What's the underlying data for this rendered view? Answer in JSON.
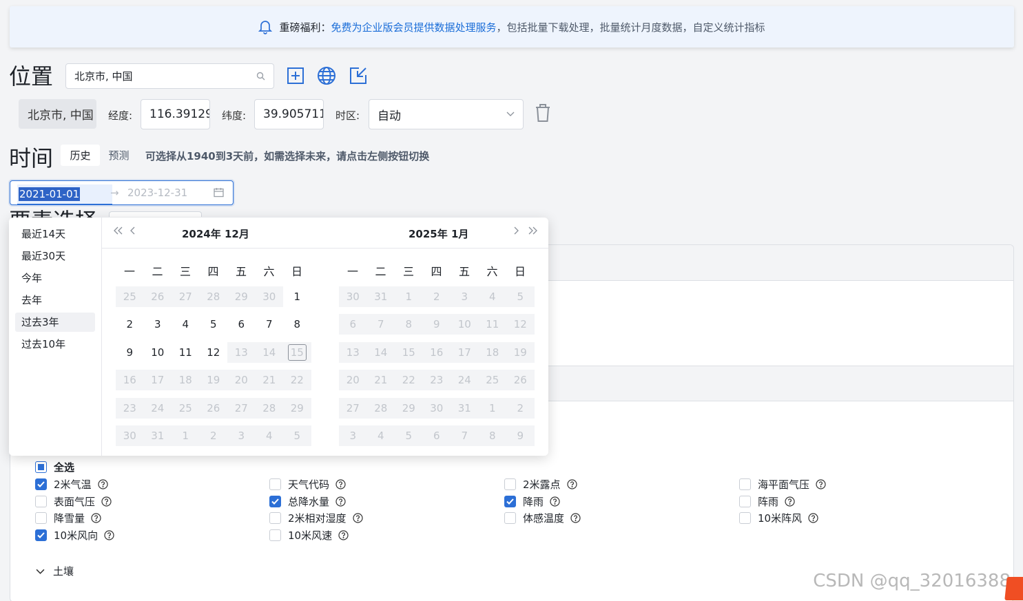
{
  "banner": {
    "lead": "重磅福利",
    "colon": "：",
    "link": "免费为企业版会员提供数据处理服务",
    "rest": "，包括批量下载处理，批量统计月度数据，自定义统计指标"
  },
  "location": {
    "heading": "位置",
    "search_value": "北京市, 中国",
    "chip": "北京市, 中国",
    "lon_label": "经度:",
    "lon_value": "116.39129",
    "lat_label": "纬度:",
    "lat_value": "39.905711",
    "tz_label": "时区:",
    "tz_value": "自动"
  },
  "time": {
    "heading": "时间",
    "tab_history": "历史",
    "tab_forecast": "预测",
    "hint": "可选择从1940到3天前，如需选择未来，请点击左侧按钮切换",
    "start": "2021-01-01",
    "arrow": "→",
    "end": "2023-12-31"
  },
  "hidden_heading": "要素选择",
  "presets": [
    "最近14天",
    "最近30天",
    "今年",
    "去年",
    "过去3年",
    "过去10年"
  ],
  "selected_preset": 4,
  "weekdays": [
    "一",
    "二",
    "三",
    "四",
    "五",
    "六",
    "日"
  ],
  "calendars": [
    {
      "title": "2024年  12月",
      "days": [
        [
          "25",
          "26",
          "27",
          "28",
          "29",
          "30",
          "1"
        ],
        [
          "2",
          "3",
          "4",
          "5",
          "6",
          "7",
          "8"
        ],
        [
          "9",
          "10",
          "11",
          "12",
          "13",
          "14",
          "15"
        ],
        [
          "16",
          "17",
          "18",
          "19",
          "20",
          "21",
          "22"
        ],
        [
          "23",
          "24",
          "25",
          "26",
          "27",
          "28",
          "29"
        ],
        [
          "30",
          "31",
          "1",
          "2",
          "3",
          "4",
          "5"
        ]
      ]
    },
    {
      "title": "2025年  1月",
      "days": [
        [
          "30",
          "31",
          "1",
          "2",
          "3",
          "4",
          "5"
        ],
        [
          "6",
          "7",
          "8",
          "9",
          "10",
          "11",
          "12"
        ],
        [
          "13",
          "14",
          "15",
          "16",
          "17",
          "18",
          "19"
        ],
        [
          "20",
          "21",
          "22",
          "23",
          "24",
          "25",
          "26"
        ],
        [
          "27",
          "28",
          "29",
          "30",
          "31",
          "1",
          "2"
        ],
        [
          "3",
          "4",
          "5",
          "6",
          "7",
          "8",
          "9"
        ]
      ]
    }
  ],
  "variables": {
    "select_all": "全选",
    "items": [
      {
        "label": "2米气温",
        "checked": true
      },
      {
        "label": "天气代码",
        "checked": false
      },
      {
        "label": "2米露点",
        "checked": false
      },
      {
        "label": "海平面气压",
        "checked": false
      },
      {
        "label": "表面气压",
        "checked": false
      },
      {
        "label": "总降水量",
        "checked": true
      },
      {
        "label": "降雨",
        "checked": true
      },
      {
        "label": "阵雨",
        "checked": false
      },
      {
        "label": "降雪量",
        "checked": false
      },
      {
        "label": "2米相对湿度",
        "checked": false
      },
      {
        "label": "体感温度",
        "checked": false
      },
      {
        "label": "10米阵风",
        "checked": false
      },
      {
        "label": "10米风向",
        "checked": true
      },
      {
        "label": "10米风速",
        "checked": false
      }
    ]
  },
  "soil_label": "土壤",
  "watermark": "CSDN @qq_32016388",
  "colors": {
    "accent": "#2c6fd6",
    "banner_bg": "#eef4fd",
    "page_bg": "#f3f4f6"
  }
}
